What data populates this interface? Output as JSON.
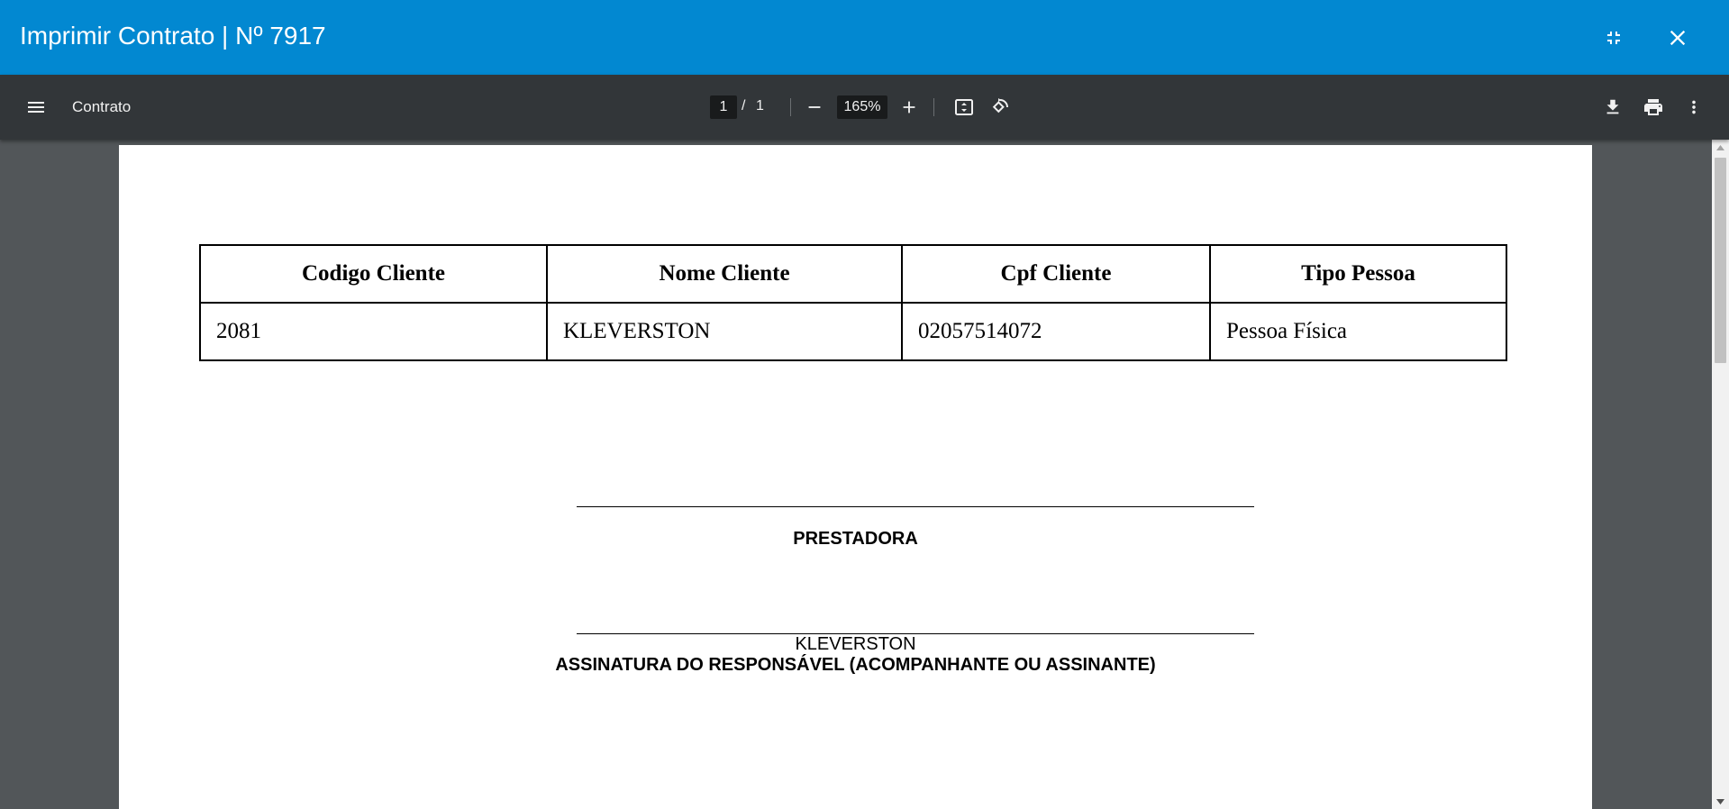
{
  "modal": {
    "title": "Imprimir Contrato | Nº 7917",
    "collapse_icon": "collapse-icon",
    "close_icon": "close-icon"
  },
  "toolbar": {
    "doc_title": "Contrato",
    "page_current": "1",
    "page_separator": "/",
    "page_total": "1",
    "zoom": "165%",
    "icons": [
      "menu-icon",
      "zoom-out-icon",
      "zoom-in-icon",
      "fit-page-icon",
      "rotate-icon",
      "download-icon",
      "print-icon",
      "more-icon"
    ]
  },
  "document": {
    "table": {
      "headers": [
        "Codigo Cliente",
        "Nome Cliente",
        "Cpf Cliente",
        "Tipo Pessoa"
      ],
      "rows": [
        [
          "2081",
          "KLEVERSTON",
          "02057514072",
          "Pessoa Física"
        ]
      ]
    },
    "signatures": {
      "prestadora_label": "PRESTADORA",
      "responsavel_name": "KLEVERSTON",
      "responsavel_label": "ASSINATURA DO RESPONSÁVEL (ACOMPANHANTE OU ASSINANTE)"
    }
  },
  "colors": {
    "titlebar": "#0288d1",
    "toolbar": "#323639",
    "viewer_bg": "#525659"
  }
}
